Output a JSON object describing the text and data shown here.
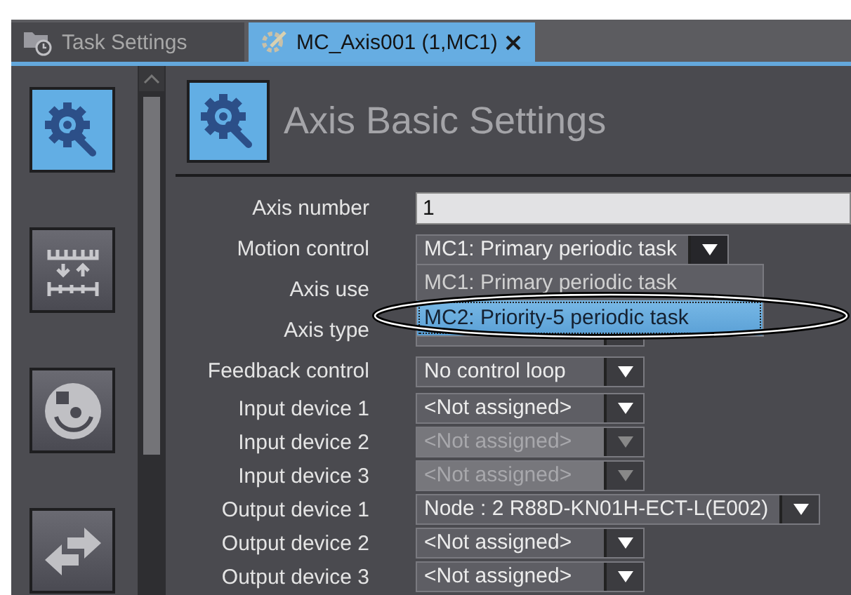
{
  "tabs": [
    {
      "label": "Task Settings",
      "selected": false,
      "closable": false
    },
    {
      "label": "MC_Axis001 (1,MC1)",
      "selected": true,
      "closable": true
    }
  ],
  "sidebar": {
    "buttons": [
      {
        "selected": true
      },
      {
        "selected": false
      },
      {
        "selected": false
      },
      {
        "selected": false
      }
    ]
  },
  "header": {
    "title": "Axis Basic Settings"
  },
  "rows": [
    {
      "label": "Axis number",
      "kind": "text",
      "value": "1"
    },
    {
      "label": "Motion control",
      "kind": "select",
      "value": "MC1: Primary periodic task",
      "disabled": false,
      "expanded": true,
      "options": [
        {
          "label": "MC1: Primary periodic task",
          "highlighted": false
        },
        {
          "label": "MC2: Priority-5 periodic task",
          "highlighted": true
        }
      ]
    },
    {
      "label": "Axis use",
      "kind": "select"
    },
    {
      "label": "Axis type",
      "kind": "select"
    },
    {
      "label": "Feedback control",
      "kind": "select",
      "value": "No control loop",
      "disabled": false
    },
    {
      "label": "Input device 1",
      "kind": "select",
      "value": "<Not assigned>",
      "disabled": false
    },
    {
      "label": "Input device 2",
      "kind": "select",
      "value": "<Not assigned>",
      "disabled": true
    },
    {
      "label": "Input device 3",
      "kind": "select",
      "value": "<Not assigned>",
      "disabled": true
    },
    {
      "label": "Output device 1",
      "kind": "select",
      "value": "Node : 2 R88D-KN01H-ECT-L(E002)",
      "disabled": false
    },
    {
      "label": "Output device 2",
      "kind": "select",
      "value": "<Not assigned>",
      "disabled": false
    },
    {
      "label": "Output device 3",
      "kind": "select",
      "value": "<Not assigned>",
      "disabled": false
    }
  ]
}
